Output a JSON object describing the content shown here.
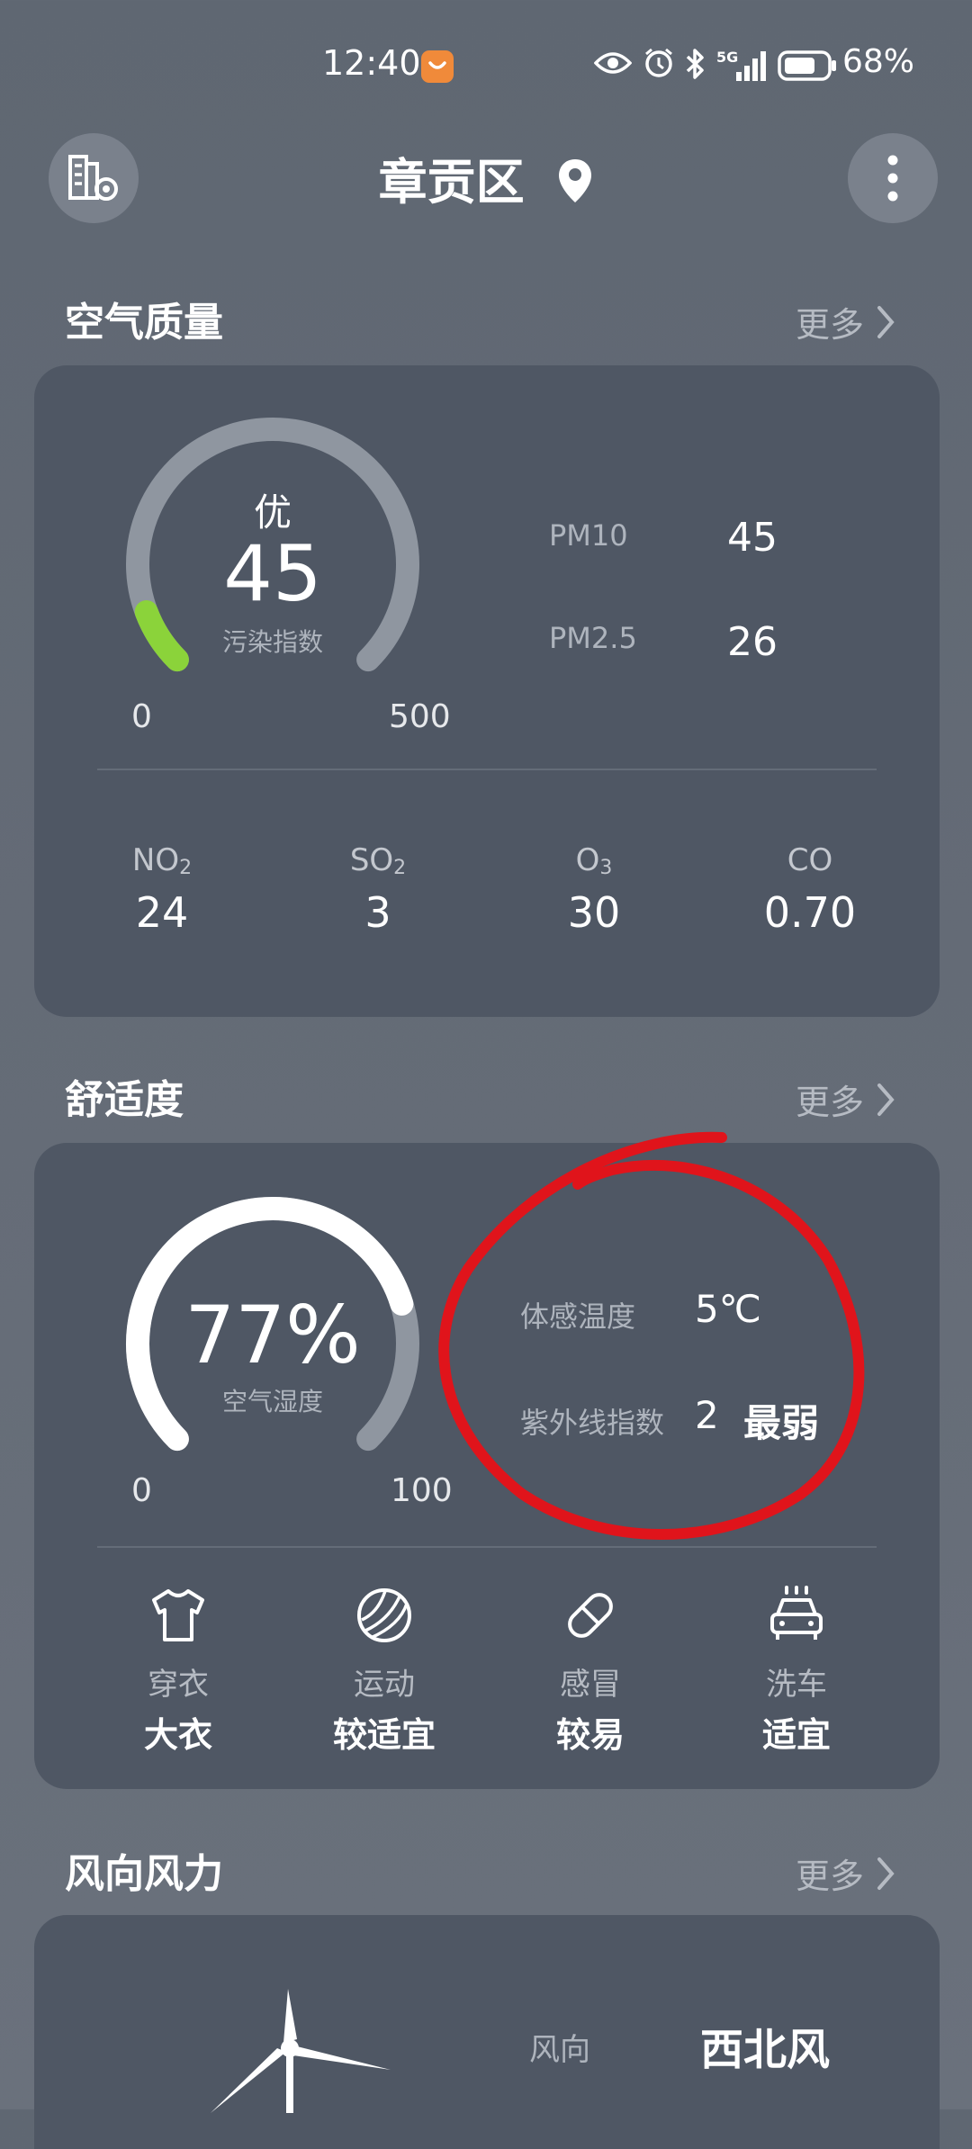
{
  "status_bar": {
    "time": "12:40",
    "battery": "68%",
    "signal_label": "5G",
    "icons": [
      "eye-icon",
      "alarm-icon",
      "bluetooth-icon",
      "signal-icon",
      "battery-icon"
    ]
  },
  "header": {
    "location": "章贡区",
    "left_button_icon": "city-settings-icon",
    "right_button_icon": "more-vertical-icon",
    "location_icon": "location-pin-icon"
  },
  "air_quality": {
    "title": "空气质量",
    "more": "更多",
    "level": "优",
    "aqi": "45",
    "aqi_label": "污染指数",
    "gauge_min": "0",
    "gauge_max": "500",
    "gauge_fraction": 0.09,
    "gauge_color": "#8bd33a",
    "pm10_label": "PM10",
    "pm10_value": "45",
    "pm25_label": "PM2.5",
    "pm25_value": "26",
    "pollutants": [
      {
        "name": "NO",
        "sub": "2",
        "value": "24"
      },
      {
        "name": "SO",
        "sub": "2",
        "value": "3"
      },
      {
        "name": "O",
        "sub": "3",
        "value": "30"
      },
      {
        "name": "CO",
        "sub": "",
        "value": "0.70"
      }
    ]
  },
  "comfort": {
    "title": "舒适度",
    "more": "更多",
    "humidity": "77%",
    "humidity_label": "空气湿度",
    "gauge_min": "0",
    "gauge_max": "100",
    "gauge_fraction": 0.77,
    "feels_like_label": "体感温度",
    "feels_like_value": "5℃",
    "uv_label": "紫外线指数",
    "uv_value": "2",
    "uv_level": "最弱",
    "annotation_color": "#e0141b",
    "tiles": [
      {
        "icon": "shirt-icon",
        "label": "穿衣",
        "value": "大衣"
      },
      {
        "icon": "ball-icon",
        "label": "运动",
        "value": "较适宜"
      },
      {
        "icon": "pill-icon",
        "label": "感冒",
        "value": "较易"
      },
      {
        "icon": "car-wash-icon",
        "label": "洗车",
        "value": "适宜"
      }
    ]
  },
  "wind": {
    "title": "风向风力",
    "more": "更多",
    "direction_label": "风向",
    "direction_value": "西北风",
    "icon": "wind-turbine-icon"
  }
}
